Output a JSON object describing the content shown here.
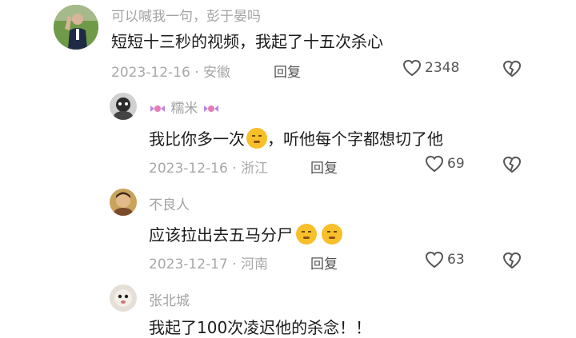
{
  "comments": [
    {
      "username": "可以喊我一句，彭于晏吗",
      "text": "短短十三秒的视频，我起了十五次杀心",
      "date_location": "2023-12-16 · 安徽",
      "reply_label": "回复",
      "likes": "2348"
    },
    {
      "username": "糯米",
      "text_before": "我比你多一次",
      "text_after": "，听他每个字都想切了他",
      "date_location": "2023-12-16 · 浙江",
      "reply_label": "回复",
      "likes": "69"
    },
    {
      "username": "不良人",
      "text": "应该拉出去五马分尸",
      "date_location": "2023-12-17 · 河南",
      "reply_label": "回复",
      "likes": "63"
    },
    {
      "username": "张北城",
      "text": "我起了100次凌迟他的杀念！！"
    }
  ],
  "icons": {
    "like": "heart-outline-icon",
    "dislike": "broken-heart-icon",
    "username_decoration": "candy-icon",
    "emoji_laugh": "rofl-emoji",
    "emoji_smirk": "smirk-emoji"
  },
  "colors": {
    "text": "#1c1c1c",
    "meta": "#a8a8a8",
    "action": "#555555"
  }
}
